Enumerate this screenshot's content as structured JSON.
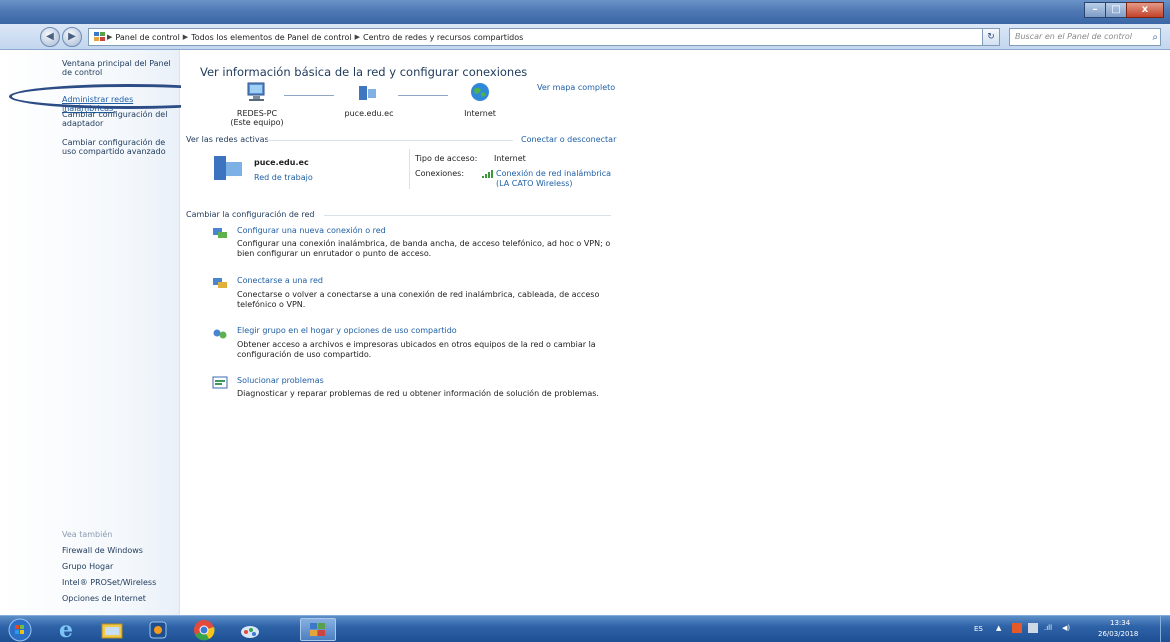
{
  "window": {
    "min_label": "–",
    "max_label": "□",
    "close_label": "x"
  },
  "nav": {
    "back": "◀",
    "forward": "▶",
    "crumbs": [
      "Panel de control",
      "Todos los elementos de Panel de control",
      "Centro de redes y recursos compartidos"
    ],
    "search_placeholder": "Buscar en el Panel de control"
  },
  "sidebar": {
    "items": [
      "Ventana principal del Panel de control",
      "Administrar redes inalámbricas",
      "Cambiar configuración del adaptador",
      "Cambiar configuración de uso compartido avanzado"
    ],
    "see_also_title": "Vea también",
    "see_also": [
      "Firewall de Windows",
      "Grupo Hogar",
      "Intel® PROSet/Wireless",
      "Opciones de Internet"
    ]
  },
  "main": {
    "heading": "Ver información básica de la red y configurar conexiones",
    "map_link": "Ver mapa completo",
    "nodes": [
      {
        "name": "REDES-PC",
        "sub": "(Este equipo)"
      },
      {
        "name": "puce.edu.ec",
        "sub": ""
      },
      {
        "name": "Internet",
        "sub": ""
      }
    ],
    "active_networks_title": "Ver las redes activas",
    "connect_link": "Conectar o desconectar",
    "network": {
      "name": "puce.edu.ec",
      "type": "Red de trabajo",
      "access_label": "Tipo de acceso:",
      "access_value": "Internet",
      "connections_label": "Conexiones:",
      "connection_value_1": "Conexión de red inalámbrica",
      "connection_value_2": "(LA CATO Wireless)"
    },
    "change_title": "Cambiar la configuración de red",
    "tasks": [
      {
        "link": "Configurar una nueva conexión o red",
        "desc": "Configurar una conexión inalámbrica, de banda ancha, de acceso telefónico, ad hoc o VPN; o bien configurar un enrutador o punto de acceso."
      },
      {
        "link": "Conectarse a una red",
        "desc": "Conectarse o volver a conectarse a una conexión de red inalámbrica, cableada, de acceso telefónico o VPN."
      },
      {
        "link": "Elegir grupo en el hogar y opciones de uso compartido",
        "desc": "Obtener acceso a archivos e impresoras ubicados en otros equipos de la red o cambiar la configuración de uso compartido."
      },
      {
        "link": "Solucionar problemas",
        "desc": "Diagnosticar y reparar problemas de red u obtener información de solución de problemas."
      }
    ]
  },
  "tray": {
    "lang": "ES",
    "time": "13:34",
    "date": "26/03/2018"
  }
}
